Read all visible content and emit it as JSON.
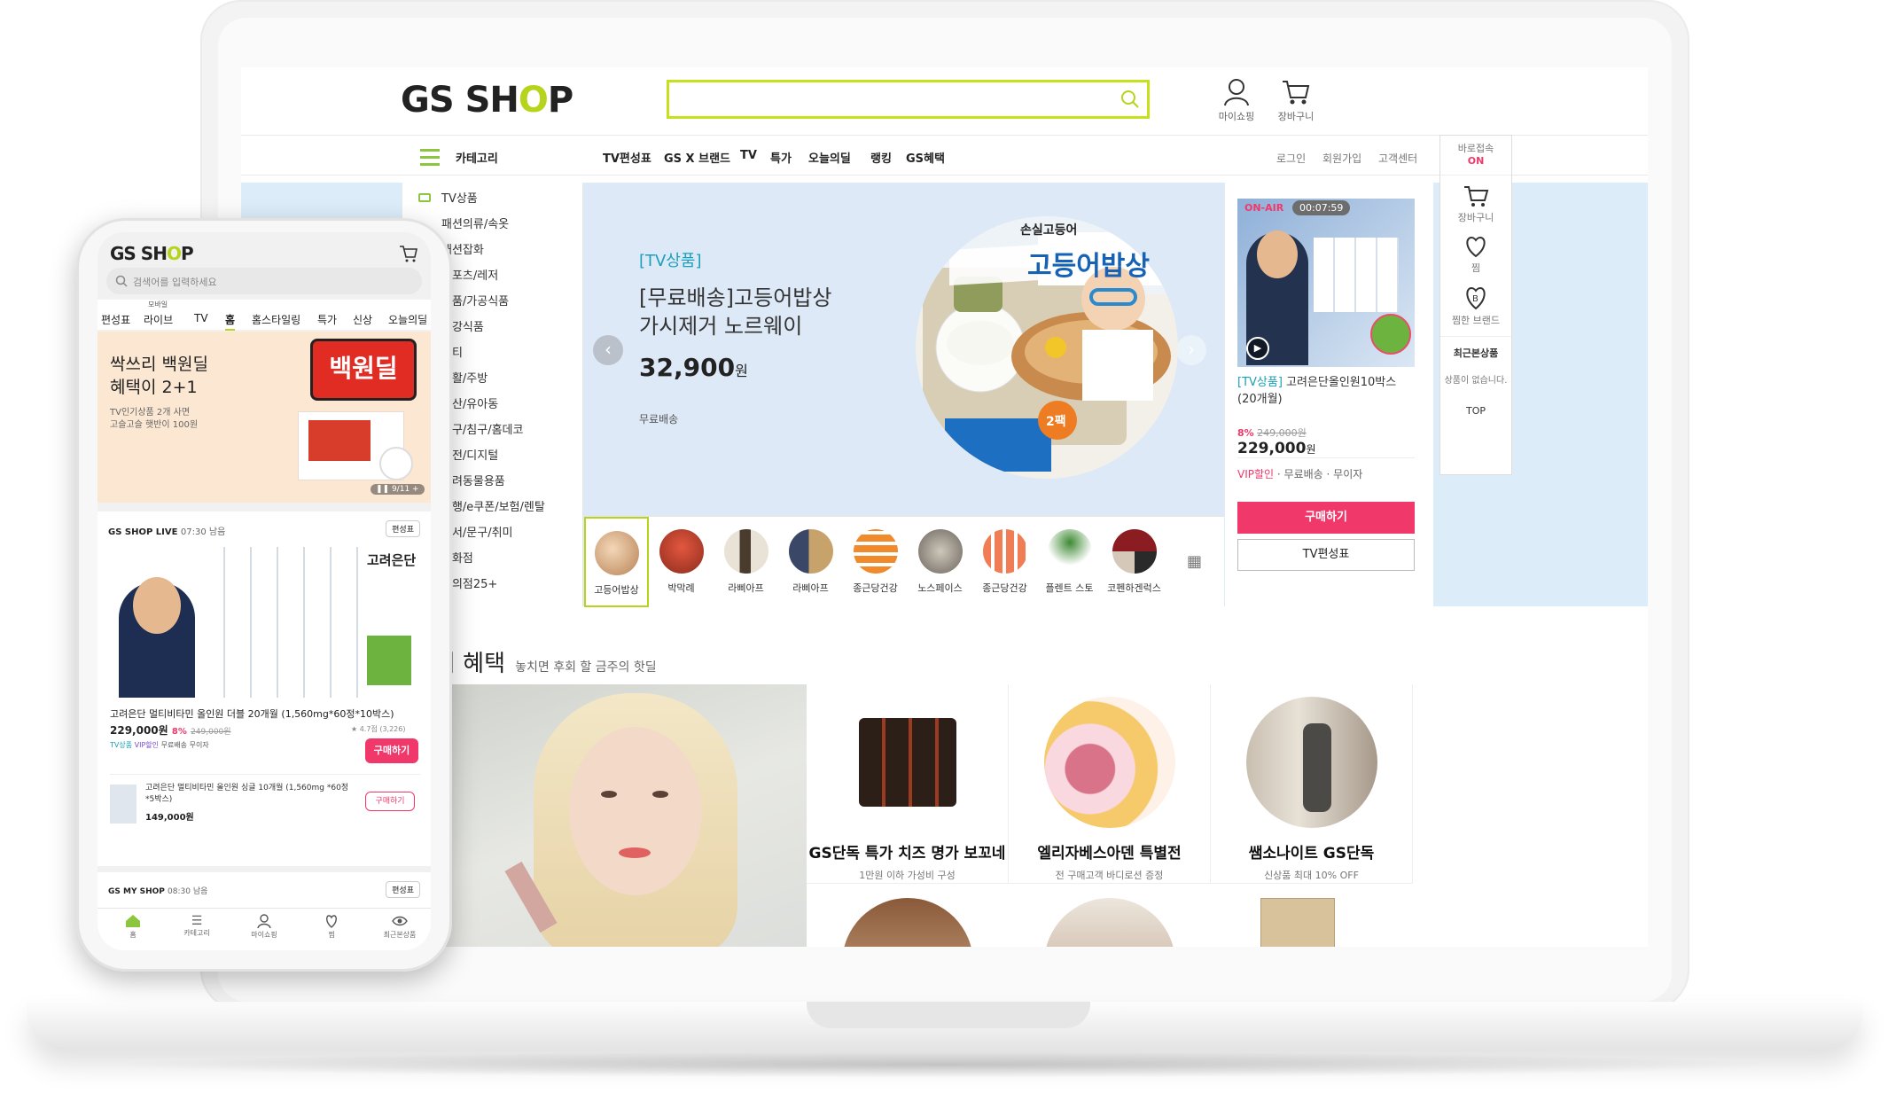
{
  "brand": {
    "logo_pre": "GS SH",
    "logo_o": "O",
    "logo_post": "P",
    "accent": "#c8df1b",
    "pink": "#f0386b"
  },
  "header": {
    "mypage": "마이쇼핑",
    "cart": "장바구니"
  },
  "nav": {
    "category": "카테고리",
    "items": [
      "TV편성표",
      "GS X 브랜드",
      "TV",
      "특가",
      "오늘의딜",
      "랭킹",
      "GS혜택"
    ],
    "util": [
      "로그인",
      "회원가입",
      "고객센터"
    ]
  },
  "categories": [
    "TV상품",
    "패션의류/속옷",
    "패션잡화",
    "스포츠/레저",
    "식품/가공식품",
    "건강식품",
    "뷰티",
    "생활/주방",
    "출산/유아동",
    "가구/침구/홈데코",
    "가전/디지털",
    "반려동물용품",
    "여행/e쿠폰/보험/렌탈",
    "도서/문구/취미",
    "꽃화점",
    "편의점25+"
  ],
  "hero": {
    "tag": "[TV상품]",
    "title1": "[무료배송]고등어밥상",
    "title2": "가시제거 노르웨이",
    "price": "32,900",
    "won": "원",
    "shipping": "무료배송",
    "badge": "2팩",
    "food_label": "고등어밥상",
    "food_label_top": "손실고등어"
  },
  "thumbs": [
    "고등어밥상",
    "박막례",
    "라삐아프",
    "라삐아프",
    "종근당건강",
    "노스페이스",
    "종근당건강",
    "플렌트 스토",
    "코펜하겐럭스"
  ],
  "live": {
    "onair": "ON-AIR",
    "time": "00:07:59",
    "tag": "[TV상품]",
    "title": "고려은단올인원10박스(20개월)",
    "discount": "8%",
    "orig": "249,000원",
    "price": "229,000",
    "won": "원",
    "vip": "VIP할인",
    "ship": "무료배송",
    "noint": "무이자",
    "buy": "구매하기",
    "schedule": "TV편성표"
  },
  "quick": {
    "direct": "바로접속",
    "on": "ON",
    "cart": "장바구니",
    "wish": "찜",
    "brand": "찜한 브랜드",
    "recent": "최근본상품",
    "empty": "상품이 없습니다.",
    "top": "TOP"
  },
  "benefit": {
    "title": "의 혜택",
    "sub": "놓치면 후회 할 금주의 핫딜"
  },
  "tiles": [
    {
      "name": "GS단독 특가 치즈 명가 보꼬네",
      "sub": "1만원 이하 가성비 구성"
    },
    {
      "name": "엘리자베스아덴 특별전",
      "sub": "전 구매고객 바디로션 증정"
    },
    {
      "name": "쌤소나이트 GS단독",
      "sub": "신상품 최대 10% OFF"
    }
  ],
  "mobile": {
    "search_ph": "검색어를 입력하세요",
    "tabs": [
      "편성표",
      "라이브",
      "TV",
      "홈",
      "홈스타일링",
      "특가",
      "신상",
      "오늘의딜"
    ],
    "live_sup": "모바일",
    "banner_t1": "싹쓰리 백원딜",
    "banner_t2": "혜택이 2+1",
    "banner_s1": "TV인기상품 2개 사면",
    "banner_s2": "고슬고슬 햇반이 100원",
    "banner_page": "9/11",
    "banner_sign": "백원딜",
    "live_brand": "GS SHOP LIVE",
    "live_time": "07:30 남음",
    "schedule": "편성표",
    "prod_brand": "고려은단",
    "prod_title": "고려은단 멀티비타민 올인원 더블 20개월 (1,560mg*60정*10박스)",
    "prod_price": "229,000원",
    "prod_disc": "8%",
    "prod_orig": "249,000원",
    "rating": "★ 4.7점 (3,226)",
    "badges": [
      "TV상품",
      "VIP할인",
      "무료배송",
      "무이자"
    ],
    "buy": "구매하기",
    "sub_title": "고려은단 멀티비타민 올인원 싱글 10개월 (1,560mg *60정*5박스)",
    "sub_price": "149,000원",
    "my_brand": "GS MY SHOP",
    "my_time": "08:30 남음",
    "bottom": [
      "홈",
      "카테고리",
      "마이쇼핑",
      "찜",
      "최근본상품"
    ]
  }
}
